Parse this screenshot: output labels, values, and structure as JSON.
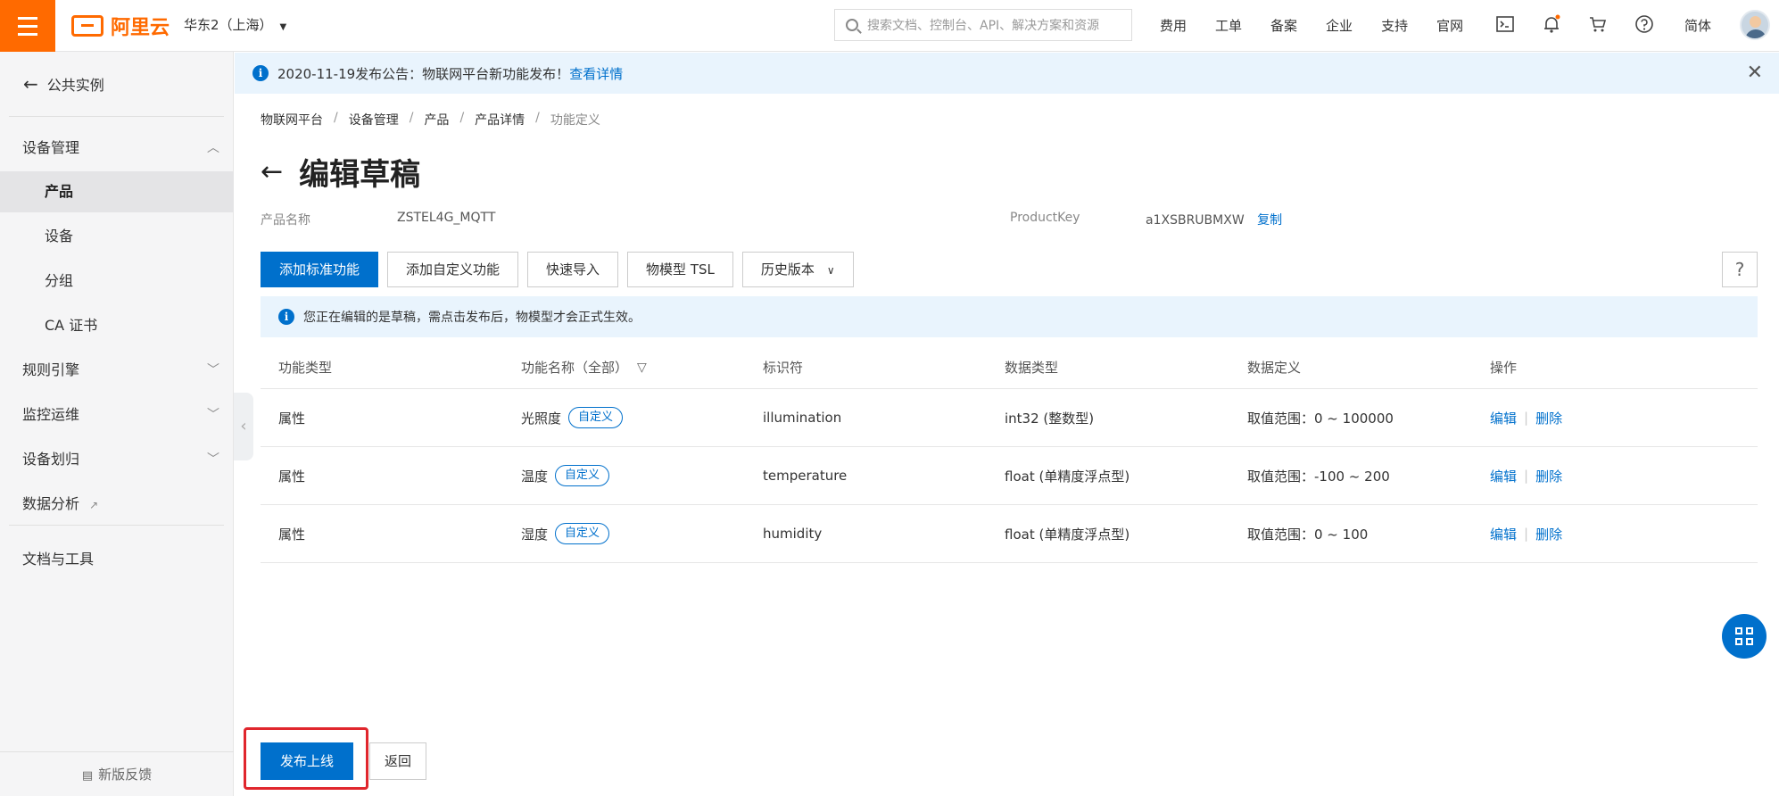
{
  "topbar": {
    "logo_text": "阿里云",
    "region": "华东2（上海）",
    "search_placeholder": "搜索文档、控制台、API、解决方案和资源",
    "nav": [
      "费用",
      "工单",
      "备案",
      "企业",
      "支持",
      "官网"
    ],
    "lang": "简体",
    "brand_color": "#ff6a00"
  },
  "sidebar": {
    "back_label": "公共实例",
    "items": [
      {
        "label": "设备管理",
        "chevron": "up"
      },
      {
        "label": "产品",
        "active": true
      },
      {
        "label": "设备"
      },
      {
        "label": "分组"
      },
      {
        "label": "CA 证书"
      },
      {
        "label": "规则引擎",
        "chevron": "down"
      },
      {
        "label": "监控运维",
        "chevron": "down"
      },
      {
        "label": "设备划归",
        "chevron": "down"
      },
      {
        "label": "数据分析",
        "external": true
      },
      {
        "label": "文档与工具"
      }
    ],
    "feedback": "新版反馈"
  },
  "notice": {
    "text": "2020-11-19发布公告：物联网平台新功能发布！",
    "link": "查看详情"
  },
  "breadcrumb": [
    "物联网平台",
    "设备管理",
    "产品",
    "产品详情",
    "功能定义"
  ],
  "page": {
    "title": "编辑草稿",
    "product_name_label": "产品名称",
    "product_name": "ZSTEL4G_MQTT",
    "product_key_label": "ProductKey",
    "product_key": "a1XSBRUBMXW",
    "copy_label": "复制"
  },
  "toolbar": {
    "add_standard": "添加标准功能",
    "add_custom": "添加自定义功能",
    "quick_import": "快速导入",
    "tsl": "物模型 TSL",
    "history": "历史版本",
    "help": "?"
  },
  "alert": {
    "text": "您正在编辑的是草稿，需点击发布后，物模型才会正式生效。"
  },
  "table": {
    "headers": [
      "功能类型",
      "功能名称（全部）",
      "标识符",
      "数据类型",
      "数据定义",
      "操作"
    ],
    "rows": [
      {
        "type": "属性",
        "name": "光照度",
        "tag": "自定义",
        "identifier": "illumination",
        "datatype": "int32 (整数型)",
        "definition": "取值范围：0 ~ 100000",
        "edit": "编辑",
        "delete": "删除"
      },
      {
        "type": "属性",
        "name": "温度",
        "tag": "自定义",
        "identifier": "temperature",
        "datatype": "float (单精度浮点型)",
        "definition": "取值范围：-100 ~ 200",
        "edit": "编辑",
        "delete": "删除"
      },
      {
        "type": "属性",
        "name": "湿度",
        "tag": "自定义",
        "identifier": "humidity",
        "datatype": "float (单精度浮点型)",
        "definition": "取值范围：0 ~ 100",
        "edit": "编辑",
        "delete": "删除"
      }
    ]
  },
  "footer": {
    "publish": "发布上线",
    "back": "返回"
  },
  "colors": {
    "primary": "#0070cc",
    "highlight": "#e0262d"
  }
}
